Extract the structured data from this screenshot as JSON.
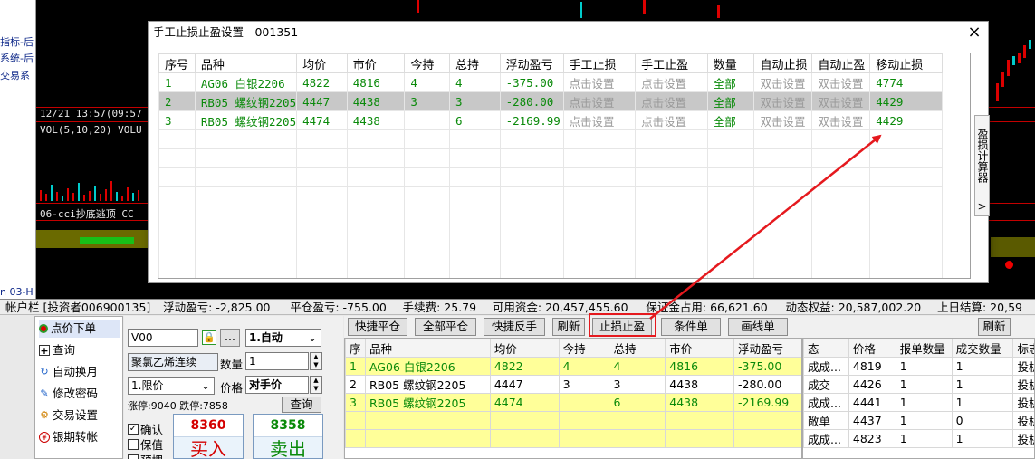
{
  "left_strip": [
    "指标-后",
    "系统-后",
    "交易系",
    "n 03-H"
  ],
  "chart": {
    "time_label": "12/21 13:57(09:57",
    "vol_label": "VOL(5,10,20) VOLU",
    "cci_label": "06-cci抄底逃顶 CC"
  },
  "dialog": {
    "title": "手工止损止盈设置 - 001351",
    "close": "×",
    "side_tab": "盈损计算器",
    "side_tab_arrow": ">",
    "headers": [
      "序号",
      "品种",
      "均价",
      "市价",
      "今持",
      "总持",
      "浮动盈亏",
      "手工止损",
      "手工止盈",
      "数量",
      "自动止损",
      "自动止盈",
      "移动止损"
    ],
    "rows": [
      [
        "1",
        "AG06 白银2206",
        "4822",
        "4816",
        "4",
        "4",
        "-375.00",
        "点击设置",
        "点击设置",
        "全部",
        "双击设置",
        "双击设置",
        "4774"
      ],
      [
        "2",
        "RB05 螺纹钢2205",
        "4447",
        "4438",
        "3",
        "3",
        "-280.00",
        "点击设置",
        "点击设置",
        "全部",
        "双击设置",
        "双击设置",
        "4429"
      ],
      [
        "3",
        "RB05 螺纹钢2205",
        "4474",
        "4438",
        "",
        "6",
        "-2169.99",
        "点击设置",
        "点击设置",
        "全部",
        "双击设置",
        "双击设置",
        "4429"
      ]
    ],
    "selected_row": 1
  },
  "account_bar": {
    "items": [
      "帐户栏 [投资者006900135]",
      "浮动盈亏: -2,825.00",
      "平仓盈亏: -755.00",
      "手续费: 25.79",
      "可用资金: 20,457,455.60",
      "保证金占用: 66,621.60",
      "动态权益: 20,587,002.20",
      "上日结算: 20,59"
    ]
  },
  "nav": {
    "items": [
      {
        "label": "点价下单",
        "icon": "red-dot-icon"
      },
      {
        "label": "查询",
        "icon": "plus-box-icon"
      },
      {
        "label": "自动换月",
        "icon": "refresh-icon"
      },
      {
        "label": "修改密码",
        "icon": "edit-icon"
      },
      {
        "label": "交易设置",
        "icon": "gear-icon"
      },
      {
        "label": "银期转帐",
        "icon": "bank-icon"
      }
    ]
  },
  "order": {
    "code": "V00",
    "lock_icon": "lock-icon",
    "more": "...",
    "mode": "1.自动",
    "product": "聚氯乙烯连续",
    "qty_label": "数量",
    "qty": "1",
    "price_type": "1.限价",
    "price_label": "价格",
    "price": "对手价",
    "limit_info": "涨停:9040 跌停:7858",
    "query_btn": "查询",
    "checkboxes": [
      {
        "label": "确认",
        "checked": true
      },
      {
        "label": "保值",
        "checked": false
      },
      {
        "label": "预埋",
        "checked": false
      }
    ],
    "buy_price": "8360",
    "buy_label": "买入",
    "sell_price": "8358",
    "sell_label": "卖出"
  },
  "positions": {
    "toolbar": [
      "快捷平仓",
      "全部平仓",
      "快捷反手",
      "刷新",
      "止损止盈",
      "条件单",
      "画线单"
    ],
    "headers": [
      "序",
      "品种",
      "均价",
      "今持",
      "总持",
      "市价",
      "浮动盈亏"
    ],
    "rows": [
      [
        "1",
        "AG06 白银2206",
        "4822",
        "4",
        "4",
        "4816",
        "-375.00"
      ],
      [
        "2",
        "RB05 螺纹钢2205",
        "4447",
        "3",
        "3",
        "4438",
        "-280.00"
      ],
      [
        "3",
        "RB05 螺纹钢2205",
        "4474",
        "",
        "6",
        "4438",
        "-2169.99"
      ]
    ]
  },
  "orders": {
    "refresh": "刷新",
    "headers": [
      "态",
      "价格",
      "报单数量",
      "成交数量",
      "标志"
    ],
    "rows": [
      [
        "成成...",
        "4819",
        "1",
        "1",
        "投机"
      ],
      [
        "成交",
        "4426",
        "1",
        "1",
        "投机"
      ],
      [
        "成成...",
        "4441",
        "1",
        "1",
        "投机"
      ],
      [
        "敞单",
        "4437",
        "1",
        "0",
        "投机"
      ],
      [
        "成成...",
        "4823",
        "1",
        "1",
        "投机"
      ]
    ]
  },
  "colors": {
    "highlight_row": "#ffff99",
    "green_text": "#0a8a0a",
    "annotation_red": "#e5191e",
    "buy_red": "#d40000",
    "sell_green": "#0a8a0a"
  }
}
